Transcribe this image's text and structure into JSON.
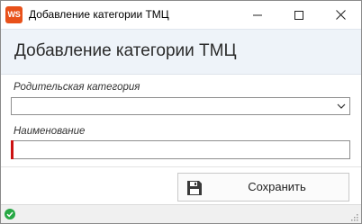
{
  "window": {
    "app_icon_text": "WS",
    "title": "Добавление категории ТМЦ"
  },
  "header": {
    "title": "Добавление категории ТМЦ"
  },
  "form": {
    "parent_category": {
      "label": "Родительская категория",
      "value": ""
    },
    "name": {
      "label": "Наименование",
      "value": "",
      "required": true
    }
  },
  "actions": {
    "save_label": "Сохранить"
  },
  "colors": {
    "app_icon": "#e8511a",
    "header_bg": "#eef3f9",
    "required_marker": "#cc1111",
    "status_ok": "#27a844"
  },
  "icons": {
    "app": "ws-logo-icon",
    "minimize": "minimize-icon",
    "maximize": "maximize-icon",
    "close": "close-icon",
    "dropdown": "chevron-down-icon",
    "save": "floppy-disk-icon",
    "status": "check-circle-icon",
    "resize": "resize-grip-icon"
  }
}
